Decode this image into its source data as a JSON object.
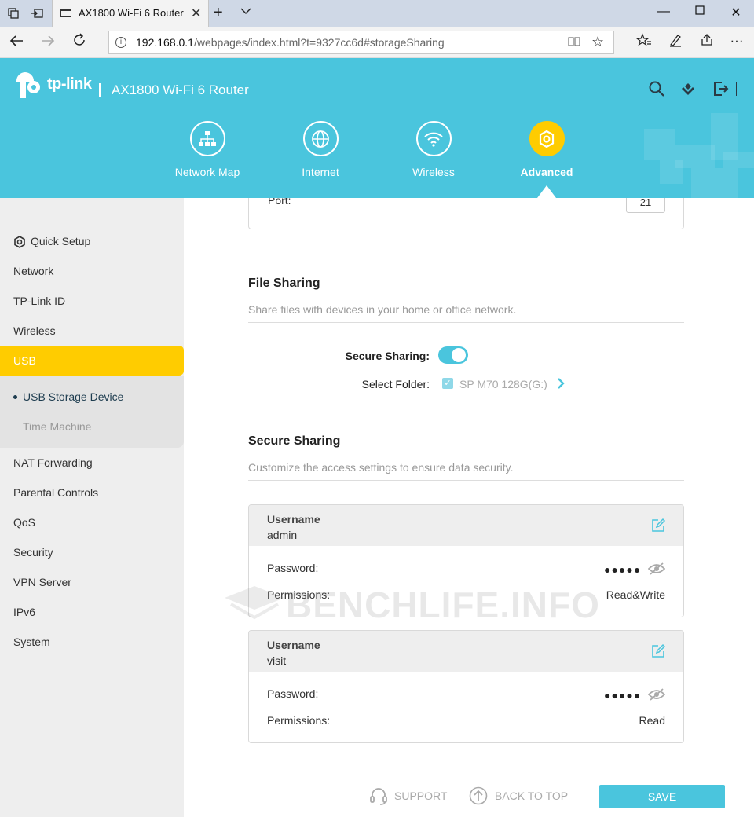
{
  "browser": {
    "tab_title": "AX1800 Wi-Fi 6 Router",
    "url_host": "192.168.0.1",
    "url_path": "/webpages/index.html?t=9327cc6d#storageSharing"
  },
  "header": {
    "logo": "tp-link",
    "product": "AX1800 Wi-Fi 6 Router",
    "nav": [
      {
        "label": "Network Map",
        "icon": "network-map-icon"
      },
      {
        "label": "Internet",
        "icon": "globe-icon"
      },
      {
        "label": "Wireless",
        "icon": "wifi-icon"
      },
      {
        "label": "Advanced",
        "icon": "gear-icon",
        "active": true
      }
    ]
  },
  "sidebar": {
    "items": [
      {
        "label": "Quick Setup"
      },
      {
        "label": "Network"
      },
      {
        "label": "TP-Link ID"
      },
      {
        "label": "Wireless"
      },
      {
        "label": "USB",
        "active": true
      },
      {
        "label": "NAT Forwarding"
      },
      {
        "label": "Parental Controls"
      },
      {
        "label": "QoS"
      },
      {
        "label": "Security"
      },
      {
        "label": "VPN Server"
      },
      {
        "label": "IPv6"
      },
      {
        "label": "System"
      }
    ],
    "usb_sub": [
      {
        "label": "USB Storage Device",
        "current": true
      },
      {
        "label": "Time Machine"
      }
    ]
  },
  "main": {
    "port_label": "Port:",
    "port_value": "21",
    "file_sharing": {
      "title": "File Sharing",
      "desc": "Share files with devices in your home or office network.",
      "secure_label": "Secure Sharing:",
      "secure_on": true,
      "folder_label": "Select Folder:",
      "folder_value": "SP M70 128G(G:)"
    },
    "secure_sharing": {
      "title": "Secure Sharing",
      "desc": "Customize the access settings to ensure data security.",
      "accounts": [
        {
          "username_label": "Username",
          "username": "admin",
          "password_label": "Password:",
          "password": "●●●●●",
          "permissions_label": "Permissions:",
          "permissions": "Read&Write"
        },
        {
          "username_label": "Username",
          "username": "visit",
          "password_label": "Password:",
          "password": "●●●●●",
          "permissions_label": "Permissions:",
          "permissions": "Read"
        }
      ]
    },
    "watermark": "BENCHLIFE.INFO"
  },
  "footer": {
    "support": "SUPPORT",
    "back_to_top": "BACK TO TOP",
    "save": "SAVE"
  },
  "colors": {
    "accent": "#4ac5dd",
    "active": "#ffcc00",
    "sidebar_bg": "#eeeeee"
  }
}
